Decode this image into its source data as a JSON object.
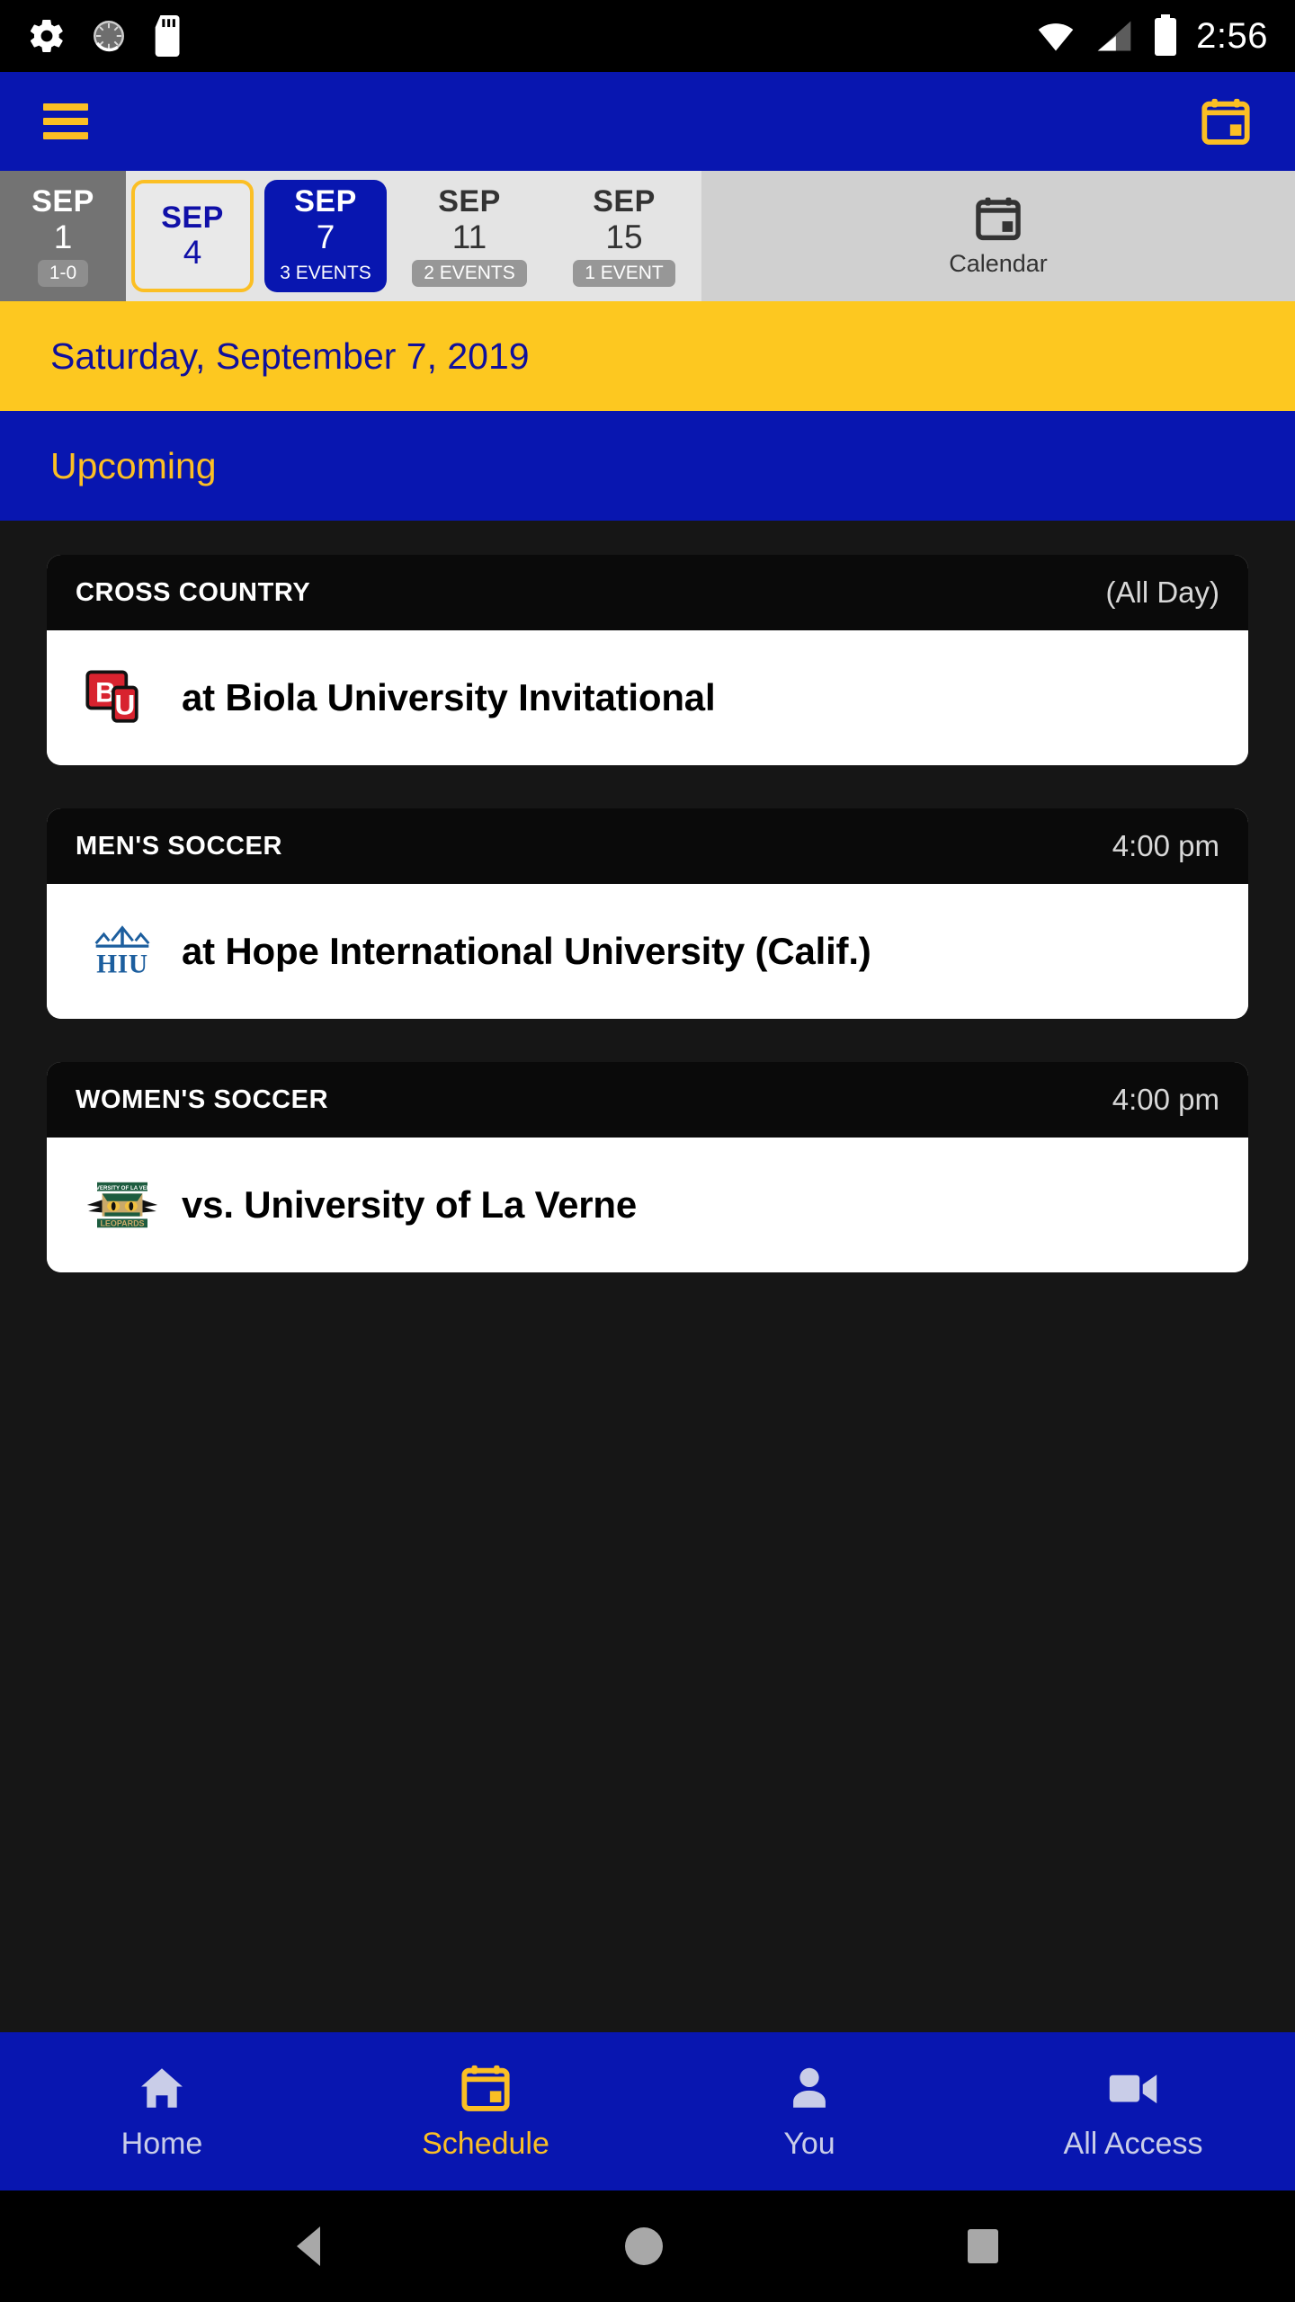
{
  "status_bar": {
    "time": "2:56",
    "icons": [
      "settings-gear-icon",
      "screen-rotation-icon",
      "sd-card-icon",
      "wifi-icon",
      "cellular-signal-icon",
      "battery-icon"
    ]
  },
  "app_bar": {
    "menu_icon": "hamburger-menu-icon",
    "calendar_icon": "calendar-icon",
    "accent_color": "#fbbf24",
    "background_color": "#0816b0"
  },
  "date_strip": {
    "tabs": [
      {
        "month": "SEP",
        "day": "1",
        "badge": "1-0",
        "state": "partial"
      },
      {
        "month": "SEP",
        "day": "4",
        "badge": "",
        "state": "outlined"
      },
      {
        "month": "SEP",
        "day": "7",
        "badge": "3 EVENTS",
        "state": "selected"
      },
      {
        "month": "SEP",
        "day": "11",
        "badge": "2 EVENTS",
        "state": "plain"
      },
      {
        "month": "SEP",
        "day": "15",
        "badge": "1 EVENT",
        "state": "plain"
      }
    ],
    "calendar_button": {
      "label": "Calendar",
      "icon": "calendar-icon"
    }
  },
  "date_header": {
    "text": "Saturday, September 7, 2019"
  },
  "section_header": {
    "text": "Upcoming"
  },
  "events": [
    {
      "sport": "CROSS COUNTRY",
      "time": "(All Day)",
      "opponent": "at Biola University Invitational",
      "logo": "biola-university-bu-logo"
    },
    {
      "sport": "MEN'S SOCCER",
      "time": "4:00 pm",
      "opponent": "at Hope International University (Calif.)",
      "logo": "hope-international-hiu-logo"
    },
    {
      "sport": "WOMEN'S SOCCER",
      "time": "4:00 pm",
      "opponent": "vs. University of La Verne",
      "logo": "university-of-la-verne-leopards-logo"
    }
  ],
  "bottom_nav": {
    "items": [
      {
        "label": "Home",
        "icon": "home-icon",
        "active": false
      },
      {
        "label": "Schedule",
        "icon": "calendar-icon",
        "active": true
      },
      {
        "label": "You",
        "icon": "person-icon",
        "active": false
      },
      {
        "label": "All Access",
        "icon": "video-icon",
        "active": false
      }
    ]
  },
  "system_nav": {
    "buttons": [
      "back-button",
      "home-button",
      "recents-button"
    ]
  }
}
